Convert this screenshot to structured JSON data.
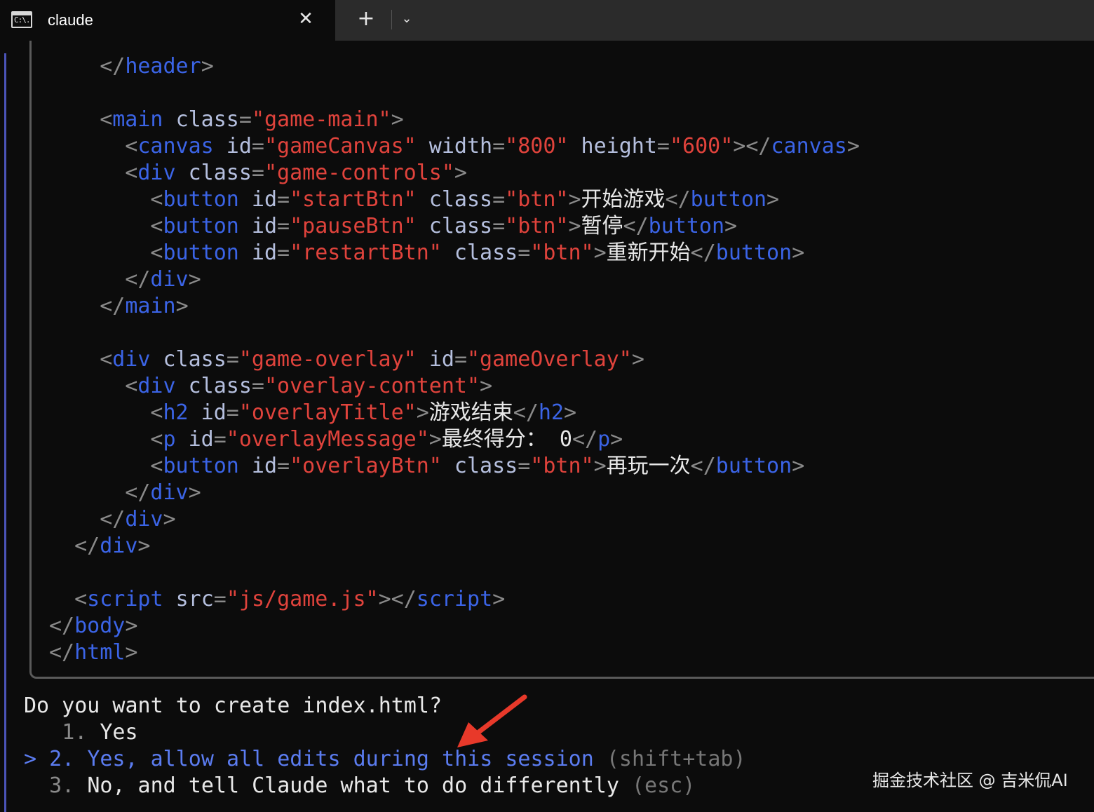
{
  "tab": {
    "icon_text": "C:\\.",
    "title": "claude",
    "close_symbol": "✕",
    "new_tab_symbol": "+",
    "dropdown_symbol": "⌄"
  },
  "code_lines": [
    {
      "indent": 4,
      "tokens": [
        [
          "p",
          "</"
        ],
        [
          "t",
          "header"
        ],
        [
          "p",
          ">"
        ]
      ]
    },
    {
      "indent": 4,
      "tokens": [
        [
          "p",
          "<"
        ],
        [
          "t",
          "main"
        ],
        [
          "w",
          " "
        ],
        [
          "a",
          "class"
        ],
        [
          "p",
          "="
        ],
        [
          "s",
          "\"game-main\""
        ],
        [
          "p",
          ">"
        ]
      ]
    },
    {
      "indent": 6,
      "tokens": [
        [
          "p",
          "<"
        ],
        [
          "t",
          "canvas"
        ],
        [
          "w",
          " "
        ],
        [
          "a",
          "id"
        ],
        [
          "p",
          "="
        ],
        [
          "s",
          "\"gameCanvas\""
        ],
        [
          "w",
          " "
        ],
        [
          "a",
          "width"
        ],
        [
          "p",
          "="
        ],
        [
          "s",
          "\"800\""
        ],
        [
          "w",
          " "
        ],
        [
          "a",
          "height"
        ],
        [
          "p",
          "="
        ],
        [
          "s",
          "\"600\""
        ],
        [
          "p",
          "></"
        ],
        [
          "t",
          "canvas"
        ],
        [
          "p",
          ">"
        ]
      ]
    },
    {
      "indent": 6,
      "tokens": [
        [
          "p",
          "<"
        ],
        [
          "t",
          "div"
        ],
        [
          "w",
          " "
        ],
        [
          "a",
          "class"
        ],
        [
          "p",
          "="
        ],
        [
          "s",
          "\"game-controls\""
        ],
        [
          "p",
          ">"
        ]
      ]
    },
    {
      "indent": 8,
      "tokens": [
        [
          "p",
          "<"
        ],
        [
          "t",
          "button"
        ],
        [
          "w",
          " "
        ],
        [
          "a",
          "id"
        ],
        [
          "p",
          "="
        ],
        [
          "s",
          "\"startBtn\""
        ],
        [
          "w",
          " "
        ],
        [
          "a",
          "class"
        ],
        [
          "p",
          "="
        ],
        [
          "s",
          "\"btn\""
        ],
        [
          "p",
          ">"
        ],
        [
          "w",
          "开始游戏"
        ],
        [
          "p",
          "</"
        ],
        [
          "t",
          "button"
        ],
        [
          "p",
          ">"
        ]
      ]
    },
    {
      "indent": 8,
      "tokens": [
        [
          "p",
          "<"
        ],
        [
          "t",
          "button"
        ],
        [
          "w",
          " "
        ],
        [
          "a",
          "id"
        ],
        [
          "p",
          "="
        ],
        [
          "s",
          "\"pauseBtn\""
        ],
        [
          "w",
          " "
        ],
        [
          "a",
          "class"
        ],
        [
          "p",
          "="
        ],
        [
          "s",
          "\"btn\""
        ],
        [
          "p",
          ">"
        ],
        [
          "w",
          "暂停"
        ],
        [
          "p",
          "</"
        ],
        [
          "t",
          "button"
        ],
        [
          "p",
          ">"
        ]
      ]
    },
    {
      "indent": 8,
      "tokens": [
        [
          "p",
          "<"
        ],
        [
          "t",
          "button"
        ],
        [
          "w",
          " "
        ],
        [
          "a",
          "id"
        ],
        [
          "p",
          "="
        ],
        [
          "s",
          "\"restartBtn\""
        ],
        [
          "w",
          " "
        ],
        [
          "a",
          "class"
        ],
        [
          "p",
          "="
        ],
        [
          "s",
          "\"btn\""
        ],
        [
          "p",
          ">"
        ],
        [
          "w",
          "重新开始"
        ],
        [
          "p",
          "</"
        ],
        [
          "t",
          "button"
        ],
        [
          "p",
          ">"
        ]
      ]
    },
    {
      "indent": 6,
      "tokens": [
        [
          "p",
          "</"
        ],
        [
          "t",
          "div"
        ],
        [
          "p",
          ">"
        ]
      ]
    },
    {
      "indent": 4,
      "tokens": [
        [
          "p",
          "</"
        ],
        [
          "t",
          "main"
        ],
        [
          "p",
          ">"
        ]
      ]
    },
    {
      "indent": 4,
      "tokens": [
        [
          "p",
          "<"
        ],
        [
          "t",
          "div"
        ],
        [
          "w",
          " "
        ],
        [
          "a",
          "class"
        ],
        [
          "p",
          "="
        ],
        [
          "s",
          "\"game-overlay\""
        ],
        [
          "w",
          " "
        ],
        [
          "a",
          "id"
        ],
        [
          "p",
          "="
        ],
        [
          "s",
          "\"gameOverlay\""
        ],
        [
          "p",
          ">"
        ]
      ]
    },
    {
      "indent": 6,
      "tokens": [
        [
          "p",
          "<"
        ],
        [
          "t",
          "div"
        ],
        [
          "w",
          " "
        ],
        [
          "a",
          "class"
        ],
        [
          "p",
          "="
        ],
        [
          "s",
          "\"overlay-content\""
        ],
        [
          "p",
          ">"
        ]
      ]
    },
    {
      "indent": 8,
      "tokens": [
        [
          "p",
          "<"
        ],
        [
          "t",
          "h2"
        ],
        [
          "w",
          " "
        ],
        [
          "a",
          "id"
        ],
        [
          "p",
          "="
        ],
        [
          "s",
          "\"overlayTitle\""
        ],
        [
          "p",
          ">"
        ],
        [
          "w",
          "游戏结束"
        ],
        [
          "p",
          "</"
        ],
        [
          "t",
          "h2"
        ],
        [
          "p",
          ">"
        ]
      ]
    },
    {
      "indent": 8,
      "tokens": [
        [
          "p",
          "<"
        ],
        [
          "t",
          "p"
        ],
        [
          "w",
          " "
        ],
        [
          "a",
          "id"
        ],
        [
          "p",
          "="
        ],
        [
          "s",
          "\"overlayMessage\""
        ],
        [
          "p",
          ">"
        ],
        [
          "w",
          "最终得分： 0"
        ],
        [
          "p",
          "</"
        ],
        [
          "t",
          "p"
        ],
        [
          "p",
          ">"
        ]
      ]
    },
    {
      "indent": 8,
      "tokens": [
        [
          "p",
          "<"
        ],
        [
          "t",
          "button"
        ],
        [
          "w",
          " "
        ],
        [
          "a",
          "id"
        ],
        [
          "p",
          "="
        ],
        [
          "s",
          "\"overlayBtn\""
        ],
        [
          "w",
          " "
        ],
        [
          "a",
          "class"
        ],
        [
          "p",
          "="
        ],
        [
          "s",
          "\"btn\""
        ],
        [
          "p",
          ">"
        ],
        [
          "w",
          "再玩一次"
        ],
        [
          "p",
          "</"
        ],
        [
          "t",
          "button"
        ],
        [
          "p",
          ">"
        ]
      ]
    },
    {
      "indent": 6,
      "tokens": [
        [
          "p",
          "</"
        ],
        [
          "t",
          "div"
        ],
        [
          "p",
          ">"
        ]
      ]
    },
    {
      "indent": 4,
      "tokens": [
        [
          "p",
          "</"
        ],
        [
          "t",
          "div"
        ],
        [
          "p",
          ">"
        ]
      ]
    },
    {
      "indent": 2,
      "tokens": [
        [
          "p",
          "</"
        ],
        [
          "t",
          "div"
        ],
        [
          "p",
          ">"
        ]
      ]
    },
    {
      "indent": 2,
      "tokens": [
        [
          "p",
          "<"
        ],
        [
          "t",
          "script"
        ],
        [
          "w",
          " "
        ],
        [
          "a",
          "src"
        ],
        [
          "p",
          "="
        ],
        [
          "s",
          "\"js/game.js\""
        ],
        [
          "p",
          "></"
        ],
        [
          "t",
          "script"
        ],
        [
          "p",
          ">"
        ]
      ]
    },
    {
      "indent": 0,
      "tokens": [
        [
          "p",
          "</"
        ],
        [
          "t",
          "body"
        ],
        [
          "p",
          ">"
        ]
      ]
    },
    {
      "indent": 0,
      "tokens": [
        [
          "p",
          "</"
        ],
        [
          "t",
          "html"
        ],
        [
          "p",
          ">"
        ]
      ]
    }
  ],
  "prompt": {
    "question": "Do you want to create index.html?",
    "cursor": ">",
    "options": [
      {
        "number": "1.",
        "label": "Yes",
        "hint": "",
        "selected": false
      },
      {
        "number": "2.",
        "label": "Yes, allow all edits during this session",
        "hint": "(shift+tab)",
        "selected": true
      },
      {
        "number": "3.",
        "label": "No, and tell Claude what to do differently",
        "hint": "(esc)",
        "selected": false
      }
    ]
  },
  "annotation": {
    "arrow_color": "#e8392a"
  },
  "watermark": "掘金技术社区 @ 吉米侃AI"
}
